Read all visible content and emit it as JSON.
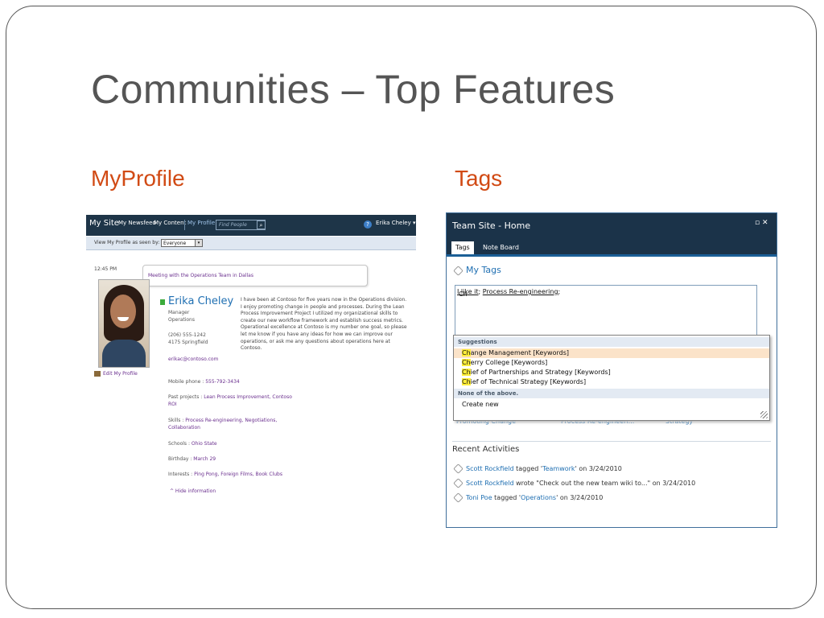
{
  "slide": {
    "title": "Communities – Top Features",
    "left_heading": "MyProfile",
    "right_heading": "Tags"
  },
  "myprofile": {
    "nav": {
      "site": "My Site",
      "newsfeed": "My Newsfeed",
      "content": "My Content",
      "profile": "My Profile",
      "search_placeholder": "Find People",
      "user": "Erika Cheley ▾"
    },
    "view_label": "View My Profile as seen by:",
    "view_value": "Everyone",
    "time": "12:45 PM",
    "status": "Meeting with the Operations Team in Dallas",
    "name": "Erika Cheley",
    "title": "Manager",
    "department": "Operations",
    "phone": "(206) 555-1242",
    "office": "4175 Springfield",
    "email": "erikac@contoso.com",
    "edit_link": "Edit My Profile",
    "bio": "I have been at Contoso for five years now in the Operations division. I enjoy promoting change in people and processes. During the Lean Process Improvement Project I utilized my organizational skills to create our new workflow framework and establish success metrics. Operational excellence at Contoso is my number one goal, so please let me know if you have any ideas for how we can improve our operations, or ask me any questions about operations here at Contoso.",
    "details": {
      "mobile_label": "Mobile phone :",
      "mobile_value": "555-792-3434",
      "projects_label": "Past projects :",
      "projects_value": "Lean Process Improvement, Contoso",
      "projects_value2": "ROI",
      "skills_label": "Skills :",
      "skills_value": "Process Re-engineering, Negotiations,",
      "skills_value2": "Collaboration",
      "schools_label": "Schools :",
      "schools_value": "Ohio State",
      "birthday_label": "Birthday :",
      "birthday_value": "March 29",
      "interests_label": "Interests :",
      "interests_value": "Ping Pong, Foreign Films, Book Clubs"
    },
    "hide_link": "^ Hide information"
  },
  "tags": {
    "window_title": "Team Site - Home",
    "tabs": [
      "Tags",
      "Note Board"
    ],
    "my_tags": "My Tags",
    "input": {
      "tag1": "I like it",
      "tag2": "Process Re-engineering",
      "typed": "Ch"
    },
    "suggestions_header": "Suggestions",
    "suggestions": [
      {
        "match": "Ch",
        "rest": "ange Management [Keywords]"
      },
      {
        "match": "Ch",
        "rest": "erry College [Keywords]"
      },
      {
        "match": "Ch",
        "rest": "ief of Partnerships and Strategy [Keywords]"
      },
      {
        "match": "Ch",
        "rest": "ief of Technical Strategy [Keywords]"
      }
    ],
    "none_header": "None of the above.",
    "create_new": "Create new",
    "under_tags": [
      "Promoting Change",
      "Process Re-engineeri...",
      "Strategy"
    ],
    "recent_title": "Recent Activities",
    "activities": [
      {
        "user": "Scott Rockfield",
        "mid": " tagged '",
        "target": "Teamwork",
        "end": "' on 3/24/2010"
      },
      {
        "user": "Scott Rockfield",
        "mid": " wrote \"Check out the new team wiki to...\" on 3/24/2010",
        "target": "",
        "end": ""
      },
      {
        "user": "Toni Poe",
        "mid": " tagged '",
        "target": "Operations",
        "end": "' on 3/24/2010"
      }
    ]
  }
}
